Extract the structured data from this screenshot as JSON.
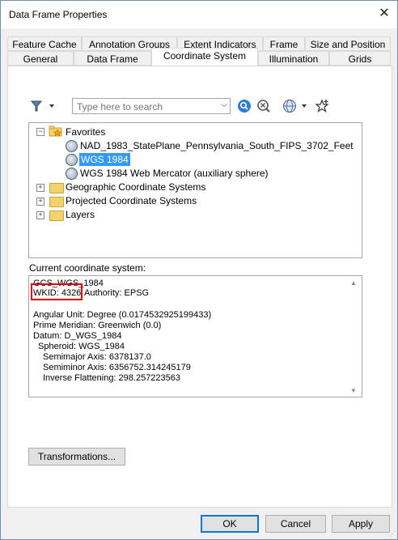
{
  "window": {
    "title": "Data Frame Properties"
  },
  "tabs_top": [
    "Feature Cache",
    "Annotation Groups",
    "Extent Indicators",
    "Frame",
    "Size and Position"
  ],
  "tabs_bottom": [
    "General",
    "Data Frame",
    "Coordinate System",
    "Illumination",
    "Grids"
  ],
  "active_tab": "Coordinate System",
  "search": {
    "placeholder": "Type here to search",
    "value": ""
  },
  "tree": {
    "favorites": "Favorites",
    "favorites_items": [
      "NAD_1983_StatePlane_Pennsylvania_South_FIPS_3702_Feet",
      "WGS 1984",
      "WGS 1984 Web Mercator (auxiliary sphere)"
    ],
    "selected": "WGS 1984",
    "folders": [
      "Geographic Coordinate Systems",
      "Projected Coordinate Systems",
      "Layers"
    ]
  },
  "current": {
    "label": "Current coordinate system:",
    "name": "GCS_WGS_1984",
    "wkid": "WKID: 4326",
    "authority": "Authority: EPSG",
    "angular_unit": "Angular Unit: Degree (0.0174532925199433)",
    "prime_meridian": "Prime Meridian: Greenwich (0.0)",
    "datum": "Datum: D_WGS_1984",
    "spheroid": "Spheroid: WGS_1984",
    "semimajor": "Semimajor Axis: 6378137.0",
    "semiminor": "Semiminor Axis: 6356752.314245179",
    "inverse_flattening": "Inverse Flattening: 298.257223563"
  },
  "buttons": {
    "transformations": "Transformations...",
    "ok": "OK",
    "cancel": "Cancel",
    "apply": "Apply"
  },
  "colors": {
    "selection": "#3399ff",
    "highlight_box": "#e00000",
    "folder": "#f2d26b"
  }
}
